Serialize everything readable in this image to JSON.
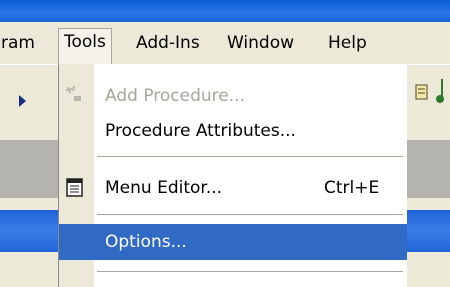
{
  "menubar": {
    "items": [
      {
        "label": "ram"
      },
      {
        "label": "Tools",
        "active": true
      },
      {
        "label": "Add-Ins"
      },
      {
        "label": "Window"
      },
      {
        "label": "Help"
      }
    ]
  },
  "tools_menu": {
    "items": [
      {
        "label": "Add Procedure...",
        "enabled": false,
        "icon": "add-procedure-icon"
      },
      {
        "label": "Procedure Attributes...",
        "enabled": true
      },
      {
        "label": "Menu Editor...",
        "shortcut": "Ctrl+E",
        "enabled": true,
        "icon": "menu-editor-icon"
      },
      {
        "label": "Options...",
        "enabled": true,
        "selected": true
      }
    ]
  },
  "colors": {
    "selection": "#316ac5",
    "titlebar": "#0a5fd8",
    "menu_background": "#ffffff",
    "disabled_text": "#a7a69a"
  }
}
